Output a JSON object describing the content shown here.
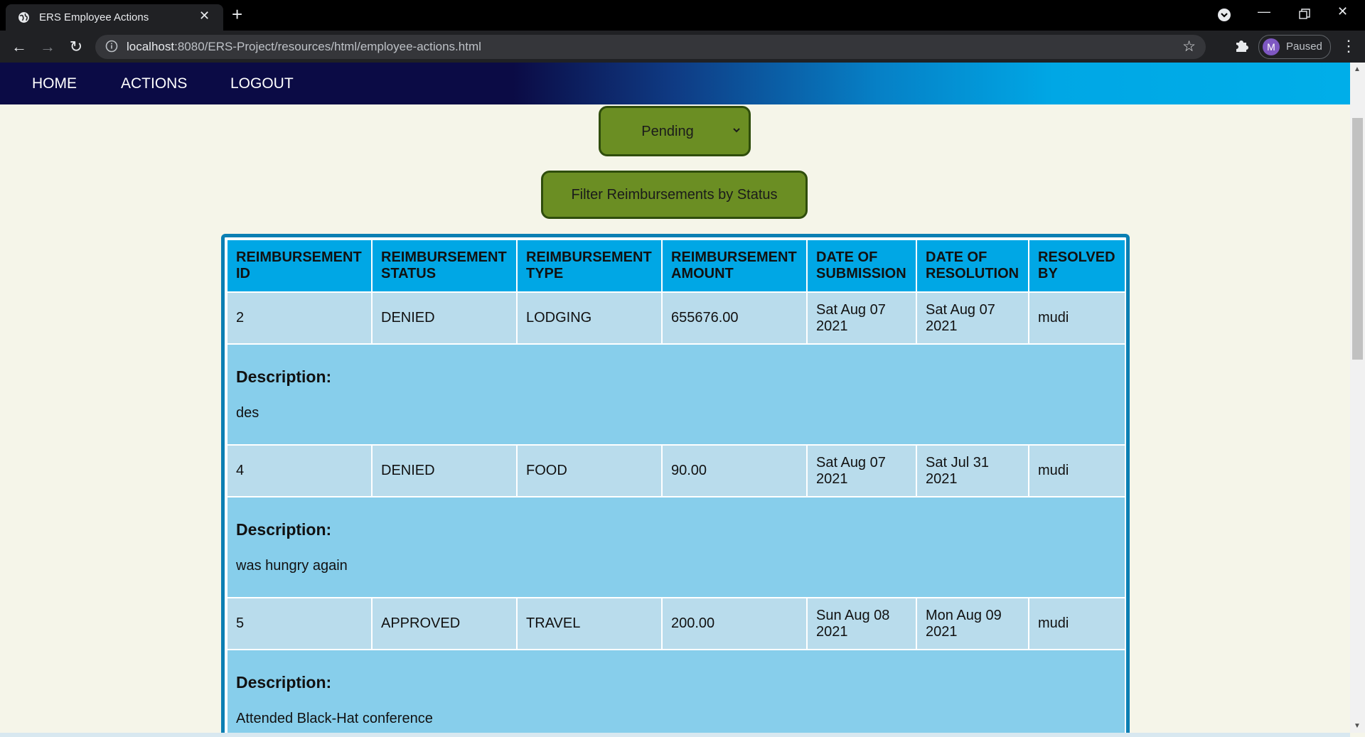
{
  "browser": {
    "tab_title": "ERS Employee Actions",
    "url_host": "localhost",
    "url_rest": ":8080/ERS-Project/resources/html/employee-actions.html",
    "profile_initial": "M",
    "profile_status": "Paused"
  },
  "nav": {
    "home": "HOME",
    "actions": "ACTIONS",
    "logout": "LOGOUT"
  },
  "filter": {
    "selected_status": "Pending",
    "button_label": "Filter Reimbursements by Status"
  },
  "table": {
    "headers": {
      "id": "REIMBURSEMENT ID",
      "status": "REIMBURSEMENT STATUS",
      "type": "REIMBURSEMENT TYPE",
      "amount": "REIMBURSEMENT AMOUNT",
      "submitted": "DATE OF SUBMISSION",
      "resolved": "DATE OF RESOLUTION",
      "resolver": "RESOLVED BY"
    },
    "description_label": "Description:",
    "rows": [
      {
        "id": "2",
        "status": "DENIED",
        "type": "LODGING",
        "amount": "655676.00",
        "submitted": "Sat Aug 07 2021",
        "resolved": "Sat Aug 07 2021",
        "resolver": "mudi",
        "description": "des"
      },
      {
        "id": "4",
        "status": "DENIED",
        "type": "FOOD",
        "amount": "90.00",
        "submitted": "Sat Aug 07 2021",
        "resolved": "Sat Jul 31 2021",
        "resolver": "mudi",
        "description": "was hungry again"
      },
      {
        "id": "5",
        "status": "APPROVED",
        "type": "TRAVEL",
        "amount": "200.00",
        "submitted": "Sun Aug 08 2021",
        "resolved": "Mon Aug 09 2021",
        "resolver": "mudi",
        "description": "Attended Black-Hat conference"
      }
    ]
  },
  "colors": {
    "nav_dark": "#0b0b45",
    "nav_light": "#00aee9",
    "button_green": "#6b8e23",
    "header_blue": "#00a7e5",
    "cell_blue": "#b9dcec",
    "desc_blue": "#87ceeb",
    "page_bg": "#f5f5e9"
  }
}
